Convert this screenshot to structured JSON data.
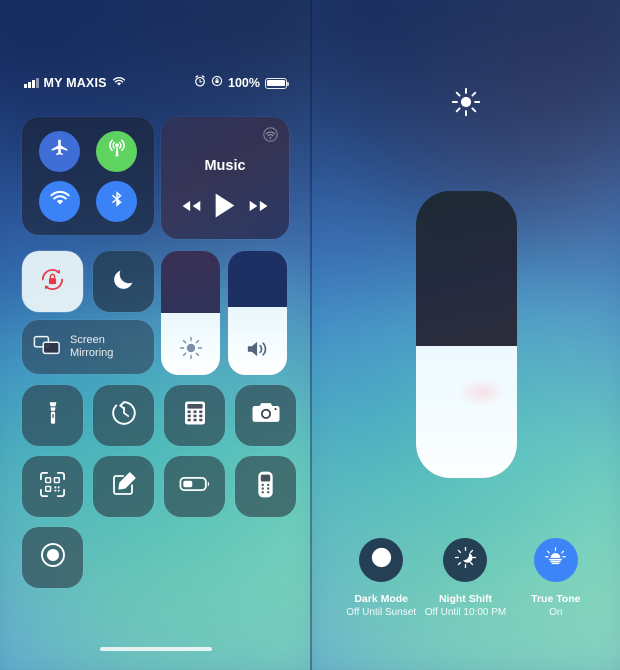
{
  "left_panel": {
    "status_bar": {
      "signal_icon": "cellular-signal-icon",
      "carrier": "MY MAXIS",
      "wifi_icon": "wifi-icon",
      "alarm_icon": "alarm-clock-icon",
      "rotation_lock_icon": "rotation-lock-icon",
      "battery_percent": "100%",
      "battery_icon": "battery-full-icon"
    },
    "connectivity": {
      "airplane": {
        "name": "airplane-mode",
        "state": "off",
        "color": "#3f6fd6"
      },
      "cellular": {
        "name": "cellular-data",
        "state": "on",
        "color": "#5fd35f"
      },
      "wifi": {
        "name": "wifi",
        "state": "on",
        "color": "#3b82f6"
      },
      "bluetooth": {
        "name": "bluetooth",
        "state": "on",
        "color": "#3b82f6"
      }
    },
    "music": {
      "title": "Music",
      "airplay_icon": "airplay-audio-icon",
      "previous_icon": "rewind-icon",
      "play_icon": "play-icon",
      "next_icon": "fast-forward-icon"
    },
    "rotation_lock": {
      "label": "rotation-lock",
      "state": "on",
      "icon_color": "#e8384a"
    },
    "do_not_disturb": {
      "label": "do-not-disturb",
      "state": "off"
    },
    "screen_mirroring": {
      "line1": "Screen",
      "line2": "Mirroring"
    },
    "brightness_slider": {
      "name": "brightness",
      "value": 50
    },
    "volume_slider": {
      "name": "volume",
      "value": 55
    },
    "apps": [
      {
        "name": "flashlight",
        "icon": "flashlight-icon"
      },
      {
        "name": "timer",
        "icon": "timer-icon"
      },
      {
        "name": "calculator",
        "icon": "calculator-icon"
      },
      {
        "name": "camera",
        "icon": "camera-icon"
      },
      {
        "name": "qr-code-scanner",
        "icon": "qr-code-icon"
      },
      {
        "name": "notes",
        "icon": "notes-pencil-icon"
      },
      {
        "name": "low-power-mode",
        "icon": "battery-low-icon"
      },
      {
        "name": "apple-tv-remote",
        "icon": "tv-remote-icon"
      },
      {
        "name": "screen-recording",
        "icon": "record-circle-icon"
      }
    ]
  },
  "right_panel": {
    "sun_icon": "sun-icon",
    "brightness_slider": {
      "name": "brightness-expanded",
      "value": 46
    },
    "toggles": [
      {
        "name": "dark-mode",
        "icon": "dark-mode-icon",
        "label": "Dark Mode",
        "state": "Off Until Sunset",
        "active": false
      },
      {
        "name": "night-shift",
        "icon": "night-shift-icon",
        "label": "Night Shift",
        "state": "Off Until 10:00 PM",
        "active": false
      },
      {
        "name": "true-tone",
        "icon": "true-tone-icon",
        "label": "True Tone",
        "state": "On",
        "active": true
      }
    ]
  },
  "colors": {
    "accent_blue": "#3d84f7",
    "active_green": "#5fd35f",
    "lock_red": "#e8384a"
  }
}
